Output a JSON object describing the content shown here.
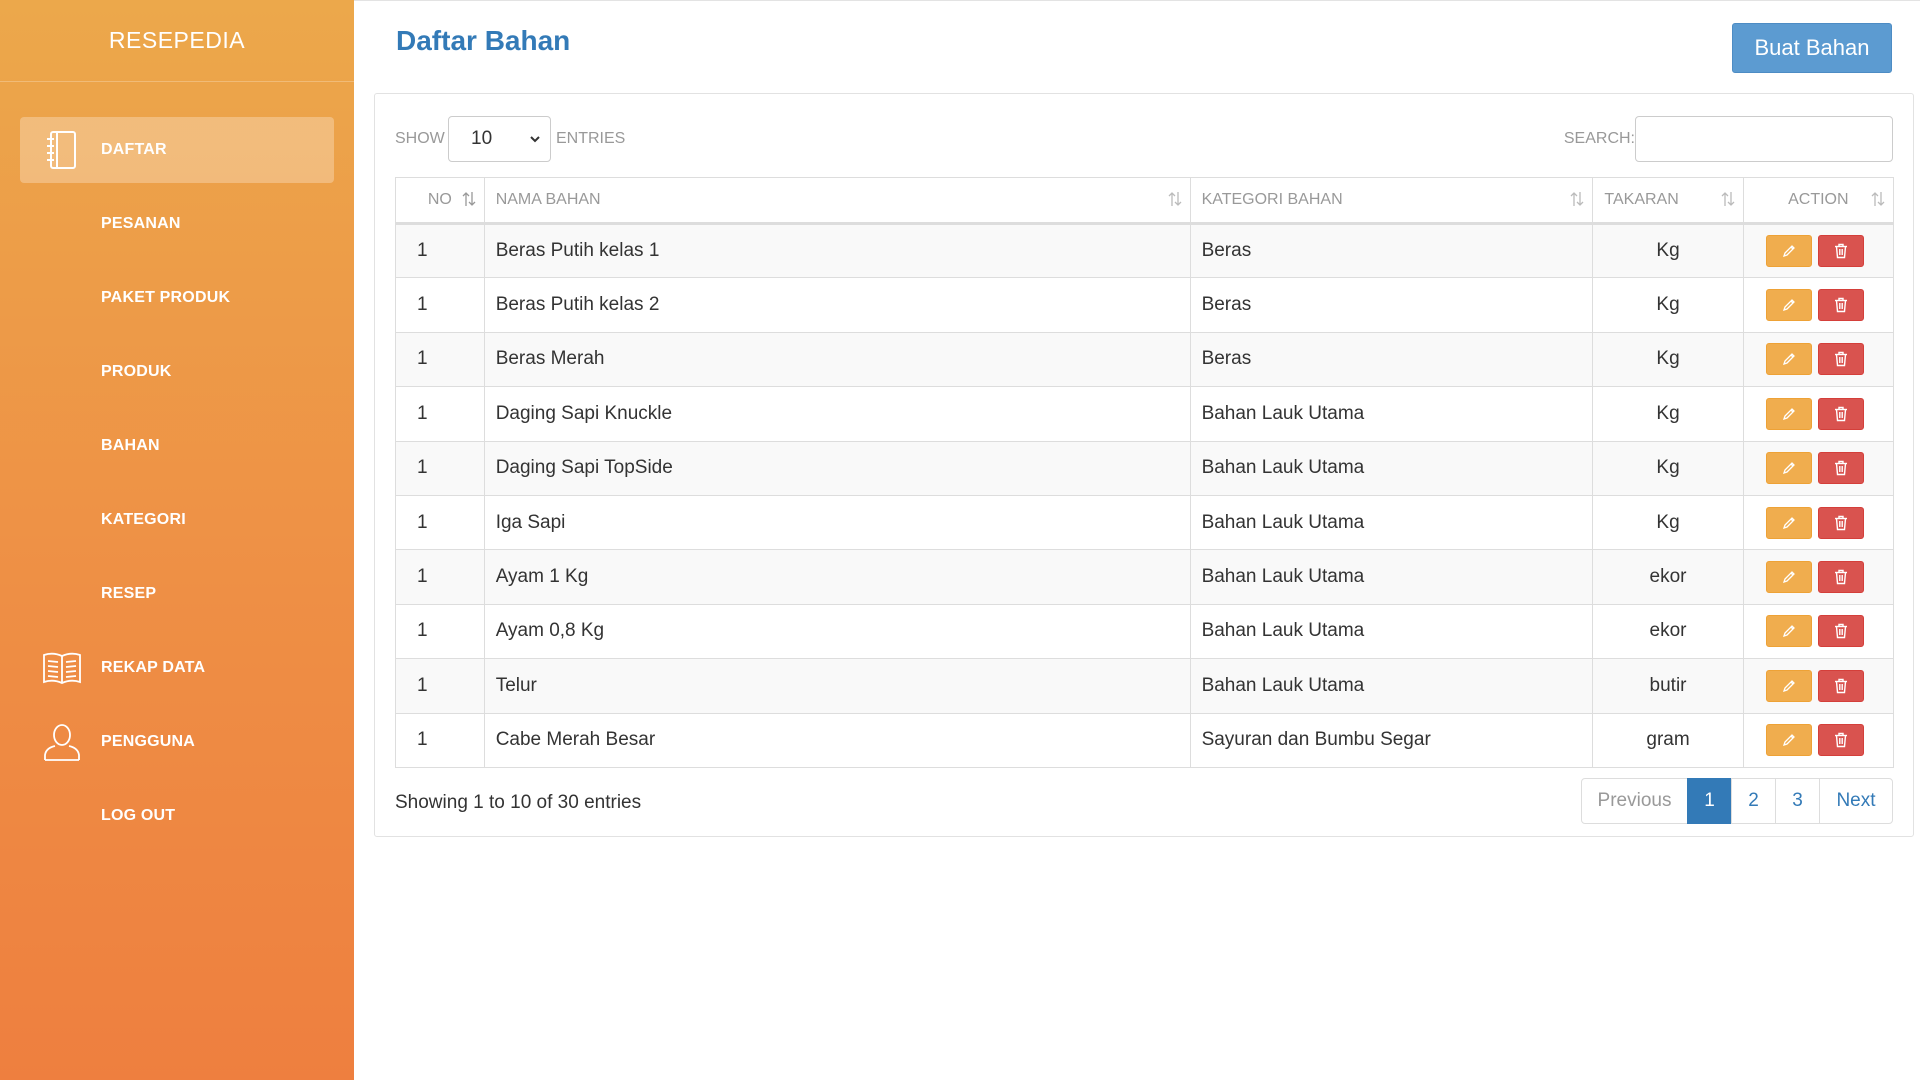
{
  "app": {
    "brand": "RESEPEDIA"
  },
  "sidebar": {
    "items": [
      {
        "label": "DAFTAR",
        "icon": "notebook-icon",
        "active": true
      },
      {
        "label": "PESANAN",
        "icon": ""
      },
      {
        "label": "PAKET PRODUK",
        "icon": ""
      },
      {
        "label": "PRODUK",
        "icon": ""
      },
      {
        "label": "BAHAN",
        "icon": ""
      },
      {
        "label": "KATEGORI",
        "icon": ""
      },
      {
        "label": "RESEP",
        "icon": ""
      },
      {
        "label": "REKAP DATA",
        "icon": "open-book-icon"
      },
      {
        "label": "PENGGUNA",
        "icon": "user-icon"
      },
      {
        "label": "LOG OUT",
        "icon": ""
      }
    ]
  },
  "header": {
    "title": "Daftar Bahan",
    "create_label": "Buat Bahan"
  },
  "table_controls": {
    "show_label": "SHOW",
    "entries_value": "10",
    "entries_label": "ENTRIES",
    "search_label": "SEARCH:",
    "search_value": ""
  },
  "table": {
    "columns": [
      "NO",
      "NAMA BAHAN",
      "KATEGORI BAHAN",
      "TAKARAN",
      "ACTION"
    ],
    "rows": [
      {
        "no": "1",
        "nama": "Beras Putih kelas 1",
        "kategori": "Beras",
        "takaran": "Kg"
      },
      {
        "no": "1",
        "nama": "Beras Putih kelas 2",
        "kategori": "Beras",
        "takaran": "Kg"
      },
      {
        "no": "1",
        "nama": "Beras Merah",
        "kategori": "Beras",
        "takaran": "Kg"
      },
      {
        "no": "1",
        "nama": "Daging Sapi Knuckle",
        "kategori": "Bahan Lauk Utama",
        "takaran": "Kg"
      },
      {
        "no": "1",
        "nama": "Daging Sapi TopSide",
        "kategori": "Bahan Lauk Utama",
        "takaran": "Kg"
      },
      {
        "no": "1",
        "nama": "Iga Sapi",
        "kategori": "Bahan Lauk Utama",
        "takaran": "Kg"
      },
      {
        "no": "1",
        "nama": "Ayam 1 Kg",
        "kategori": "Bahan Lauk Utama",
        "takaran": "ekor"
      },
      {
        "no": "1",
        "nama": "Ayam 0,8 Kg",
        "kategori": "Bahan Lauk Utama",
        "takaran": "ekor"
      },
      {
        "no": "1",
        "nama": "Telur",
        "kategori": "Bahan Lauk Utama",
        "takaran": "butir"
      },
      {
        "no": "1",
        "nama": "Cabe Merah Besar",
        "kategori": "Sayuran dan Bumbu Segar",
        "takaran": "gram"
      }
    ]
  },
  "footer": {
    "info": "Showing 1 to 10 of 30 entries",
    "pagination": {
      "previous": "Previous",
      "pages": [
        "1",
        "2",
        "3"
      ],
      "current": "1",
      "next": "Next"
    }
  },
  "colors": {
    "sidebar_top": "#eca84b",
    "sidebar_bottom": "#ee7f3f",
    "primary": "#337ab7",
    "create_button": "#5c9bd1",
    "edit_button": "#f0ad4e",
    "delete_button": "#d9534f"
  }
}
